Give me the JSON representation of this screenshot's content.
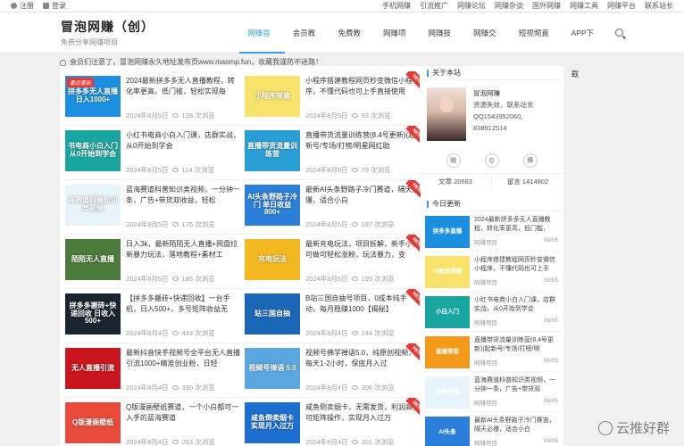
{
  "topbar": {
    "left": [
      {
        "label": "注册"
      },
      {
        "label": "登录"
      }
    ],
    "right": [
      "手机网赚",
      "引流推广",
      "网赚论坛",
      "网赚杂谈",
      "国外网赚",
      "网赚工具",
      "网赚平台",
      "联系站长"
    ]
  },
  "header": {
    "title": "冒泡网赚（创）",
    "subtitle": "免费分享网赚项目",
    "nav": [
      "网赚首页",
      "会员教程",
      "免费教程",
      "网赚项目",
      "网赚技术",
      "网赚交流",
      "短视频直播",
      "APP下载"
    ]
  },
  "notice": "会员们注意了，冒泡网赚永久地址发布页www.maomp.fun，收藏我谨防不迷路！",
  "posts": [
    {
      "title": "2024最新拼多多无人直播教程，转化率更高，低门槛，轻松实现每",
      "date": "2024年8月5日",
      "views": "128 次浏览",
      "thumb": "#1d8fe0",
      "thumb_text": "拼多多无人直播 日入1000+",
      "badge": "最近更新",
      "new": false
    },
    {
      "title": "小程序搭建教程网页秒变微信小程序，不懂代码也可上手直接使用",
      "date": "2024年8月5日",
      "views": "93 次浏览",
      "thumb": "#f7e26b",
      "thumb_text": "小程序搭建",
      "new": true
    },
    {
      "title": "小红书电商小白入门课，店群实战，从0开始到学会",
      "date": "2024年8月5日",
      "views": "114 次浏览",
      "thumb": "#1aa6a0",
      "thumb_text": "书电商小白入门 从0开始到学会",
      "new": false
    },
    {
      "title": "直播带货流量训练营(8.4号更新)(起新号/专场/打榜/明星网红助",
      "date": "2024年8月5日",
      "views": "79 次浏览",
      "thumb": "#2a9fd6",
      "thumb_text": "直播带货流量训练营",
      "new": true
    },
    {
      "title": "蓝海赛道科普知识类视频，一分钟一条，广告+带货双收益，轻松",
      "date": "2024年8月5日",
      "views": "176 次浏览",
      "thumb": "#e8f4fb",
      "thumb_text": "海赛道科普知识类视频",
      "new": false
    },
    {
      "title": "最新AI头条野路子冷门赛道，隔天必爆，适合小白",
      "date": "2024年8月5日",
      "views": "187 次浏览",
      "thumb": "#2b7fd8",
      "thumb_text": "AI头条野路子冷门 单日收益800+",
      "new": true
    },
    {
      "title": "日入3k，最新陌陌无人直播+网盘拉新暴力玩法，落地教程+素材工",
      "date": "2024年8月5日",
      "views": "185 次浏览",
      "thumb": "#4b7a3a",
      "thumb_text": "陌陌无人直播",
      "new": false
    },
    {
      "title": "最新充电玩法，项目拆解，新手小白可做可轻松涨粉，玩法暴力，变",
      "date": "2024年8月5日",
      "views": "195 次浏览",
      "thumb": "#f3b820",
      "thumb_text": "充电玩法",
      "new": true
    },
    {
      "title": "【拼多多搬砖+快递回收】一台手机，日入500+，多号矩阵收益无",
      "date": "2024年8月4日",
      "views": "433 次浏览",
      "thumb": "#1b2530",
      "thumb_text": "拼多多搬砖+快递回收 日收入500+",
      "new": false
    },
    {
      "title": "B站三国自抽号项目，0成本纯手动，每月稳赚1000【揭秘】",
      "date": "2024年8月4日",
      "views": "244 次浏览",
      "thumb": "#1a67b8",
      "thumb_text": "站三国自抽",
      "new": true
    },
    {
      "title": "最新抖音快手视频号全平台无人直播引流1000+精准创业粉，日轻",
      "date": "2024年8月4日",
      "views": "330 次浏览",
      "thumb": "#c9151e",
      "thumb_text": "无人直播引流",
      "new": false
    },
    {
      "title": "视频号佛学禅语5.0，纯原创视频，每天1-2小时，保底月入过",
      "date": "2024年8月4日",
      "views": "306 次浏览",
      "thumb": "#5aa7e0",
      "thumb_text": "视频号禅语 5.0",
      "new": true
    },
    {
      "title": "Q版漫画壁纸赛道，一个小白都可一入手的蓝海赛道",
      "date": "2024年8月4日",
      "views": "263 次浏览",
      "thumb": "#e94a3a",
      "thumb_text": "Q版漫画壁纸",
      "new": false
    },
    {
      "title": "咸鱼倒卖烟卡，无需发货，利润高，可矩阵操作，实现月入过万",
      "date": "2024年8月4日",
      "views": "301 次浏览",
      "thumb": "#1c6fd0",
      "thumb_text": "咸鱼倒卖烟卡 实现月入过万",
      "new": true
    }
  ],
  "about": {
    "heading": "关于本站",
    "name": "冒泡网赚",
    "desc": "资源失效，联系站长",
    "qq": "QQ1543952060,",
    "qq2": "838912514",
    "social": [
      "wechat-icon",
      "qq-icon",
      "weibo-icon"
    ],
    "stats": [
      {
        "label": "文章 20663"
      },
      {
        "label": "留言 1414802"
      }
    ]
  },
  "recent": {
    "heading": "今日更新",
    "items": [
      {
        "title": "2024最新拼多多无人直播教程，转化率更高，低门槛，",
        "date": "08/05",
        "thumb": "#1d8fe0",
        "thumb_text": "拼多多直播"
      },
      {
        "title": "小程序搭建教程网页秒变微信小程序，不懂代码也可上手",
        "date": "08/05",
        "thumb": "#f7e26b",
        "thumb_text": "小程序搭建"
      },
      {
        "title": "小红书电商小白入门课，店群实战，从0开始到学会",
        "date": "08/05",
        "thumb": "#1aa6a0",
        "thumb_text": "小白入门"
      },
      {
        "title": "直播带货流量训练营(8.4号更新)(起新号/专场/打榜/明",
        "date": "08/05",
        "thumb": "#f39a1a",
        "thumb_text": "直播带货"
      },
      {
        "title": "蓝海赛道科普知识类视频，一分钟一条，广告+带货双",
        "date": "08/05",
        "thumb": "#e8f4fb",
        "thumb_text": "科普知识"
      },
      {
        "title": "最新AI头条野路子冷门赛道，隔天必爆，适合小白",
        "date": "08/05",
        "thumb": "#2b7fd8",
        "thumb_text": "AI头条"
      }
    ]
  },
  "watermark": "云推好群"
}
